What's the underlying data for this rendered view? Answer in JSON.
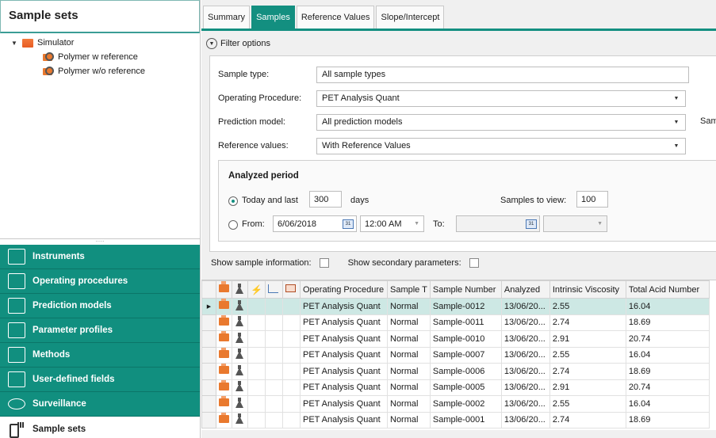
{
  "left_panel": {
    "title": "Sample sets",
    "tree": {
      "root": "Simulator",
      "children": [
        "Polymer w reference",
        "Polymer w/o reference"
      ]
    },
    "splitter_grip": ".....",
    "nav": [
      {
        "label": "Instruments",
        "icon": "instrument-icon"
      },
      {
        "label": "Operating procedures",
        "icon": "procedure-icon"
      },
      {
        "label": "Prediction models",
        "icon": "prediction-chart-icon"
      },
      {
        "label": "Parameter profiles",
        "icon": "parameter-chart-icon"
      },
      {
        "label": "Methods",
        "icon": "method-icon"
      },
      {
        "label": "User-defined fields",
        "icon": "field-icon"
      },
      {
        "label": "Surveillance",
        "icon": "eye-icon"
      },
      {
        "label": "Sample sets",
        "icon": "sample-set-icon",
        "active": true
      }
    ]
  },
  "tabs": [
    "Summary",
    "Samples",
    "Reference Values",
    "Slope/Intercept"
  ],
  "active_tab": "Samples",
  "filter": {
    "toggle_label": "Filter options",
    "sample_type_label": "Sample type:",
    "sample_type_value": "All sample types",
    "operating_procedure_label": "Operating Procedure:",
    "operating_procedure_value": "PET Analysis Quant",
    "prediction_model_label": "Prediction model:",
    "prediction_model_value": "All prediction models",
    "prediction_model_cutoff": "Samp",
    "reference_values_label": "Reference values:",
    "reference_values_value": "With Reference Values",
    "analyzed_period": {
      "title": "Analyzed period",
      "today_label": "Today and last",
      "days_value": "300",
      "days_label": "days",
      "samples_to_view_label": "Samples to view:",
      "samples_to_view_value": "100",
      "from_label": "From:",
      "from_date": "6/06/2018",
      "from_time": "12:00 AM",
      "to_label": "To:",
      "calendar_glyph": "31"
    }
  },
  "info_row": {
    "show_sample_info": "Show sample information:",
    "show_secondary": "Show secondary parameters:"
  },
  "grid": {
    "columns": [
      "Operating Procedure",
      "Sample T",
      "Sample Number",
      "Analyzed",
      "Intrinsic Viscosity",
      "Total Acid Number"
    ],
    "rows": [
      [
        "PET Analysis Quant",
        "Normal",
        "Sample-0012",
        "13/06/20...",
        "2.55",
        "16.04"
      ],
      [
        "PET Analysis Quant",
        "Normal",
        "Sample-0011",
        "13/06/20...",
        "2.74",
        "18.69"
      ],
      [
        "PET Analysis Quant",
        "Normal",
        "Sample-0010",
        "13/06/20...",
        "2.91",
        "20.74"
      ],
      [
        "PET Analysis Quant",
        "Normal",
        "Sample-0007",
        "13/06/20...",
        "2.55",
        "16.04"
      ],
      [
        "PET Analysis Quant",
        "Normal",
        "Sample-0006",
        "13/06/20...",
        "2.74",
        "18.69"
      ],
      [
        "PET Analysis Quant",
        "Normal",
        "Sample-0005",
        "13/06/20...",
        "2.91",
        "20.74"
      ],
      [
        "PET Analysis Quant",
        "Normal",
        "Sample-0002",
        "13/06/20...",
        "2.55",
        "16.04"
      ],
      [
        "PET Analysis Quant",
        "Normal",
        "Sample-0001",
        "13/06/20...",
        "2.74",
        "18.69"
      ]
    ]
  },
  "colors": {
    "accent": "#138f80",
    "selected_row": "#cde8e4"
  }
}
